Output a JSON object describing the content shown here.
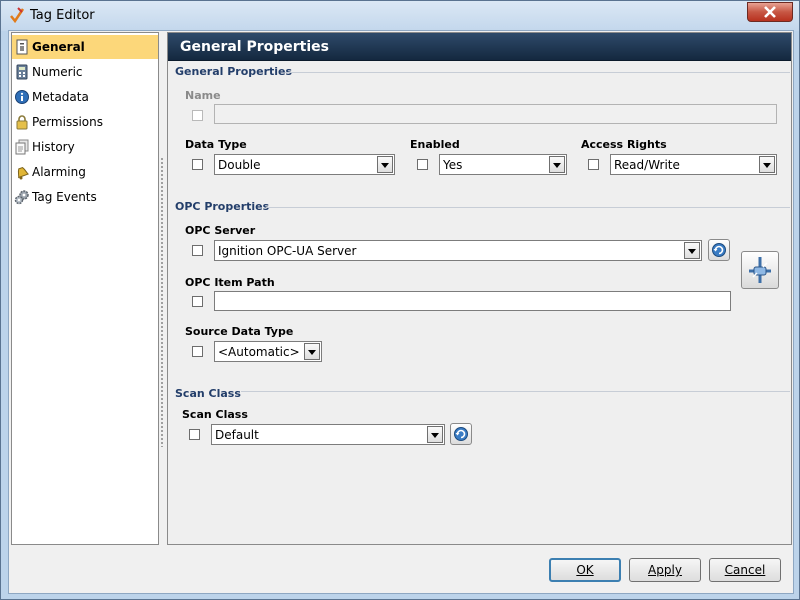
{
  "window": {
    "title": "Tag Editor"
  },
  "sidebar": {
    "items": [
      {
        "label": "General",
        "icon": "general-page-icon",
        "selected": true
      },
      {
        "label": "Numeric",
        "icon": "calculator-icon",
        "selected": false
      },
      {
        "label": "Metadata",
        "icon": "info-icon",
        "selected": false
      },
      {
        "label": "Permissions",
        "icon": "lock-icon",
        "selected": false
      },
      {
        "label": "History",
        "icon": "history-icon",
        "selected": false
      },
      {
        "label": "Alarming",
        "icon": "bell-icon",
        "selected": false
      },
      {
        "label": "Tag Events",
        "icon": "gears-icon",
        "selected": false
      }
    ]
  },
  "main": {
    "header": "General Properties",
    "general": {
      "title": "General Properties",
      "name_label": "Name",
      "name_value": "",
      "data_type_label": "Data Type",
      "data_type_value": "Double",
      "enabled_label": "Enabled",
      "enabled_value": "Yes",
      "access_label": "Access Rights",
      "access_value": "Read/Write"
    },
    "opc": {
      "title": "OPC Properties",
      "server_label": "OPC Server",
      "server_value": "Ignition OPC-UA Server",
      "item_path_label": "OPC Item Path",
      "item_path_value": "",
      "source_type_label": "Source Data Type",
      "source_type_value": "<Automatic>"
    },
    "scan": {
      "title": "Scan Class",
      "label": "Scan Class",
      "value": "Default"
    }
  },
  "buttons": {
    "ok": "OK",
    "apply": "Apply",
    "cancel": "Cancel"
  },
  "colors": {
    "selection": "#fcd77a",
    "header": "#1e3450",
    "section_title": "#233e6a"
  }
}
